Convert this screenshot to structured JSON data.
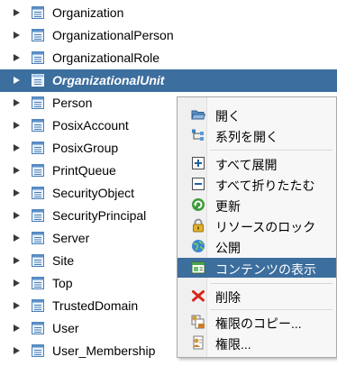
{
  "tree": {
    "items": [
      {
        "label": "Organization"
      },
      {
        "label": "OrganizationalPerson"
      },
      {
        "label": "OrganizationalRole"
      },
      {
        "label": "OrganizationalUnit"
      },
      {
        "label": "Person"
      },
      {
        "label": "PosixAccount"
      },
      {
        "label": "PosixGroup"
      },
      {
        "label": "PrintQueue"
      },
      {
        "label": "SecurityObject"
      },
      {
        "label": "SecurityPrincipal"
      },
      {
        "label": "Server"
      },
      {
        "label": "Site"
      },
      {
        "label": "Top"
      },
      {
        "label": "TrustedDomain"
      },
      {
        "label": "User"
      },
      {
        "label": "User_Membership"
      }
    ],
    "selected_label": "OrganizationalUnit"
  },
  "context_menu": {
    "items": [
      {
        "label": "開く",
        "icon": "folder-open-icon"
      },
      {
        "label": "系列を開く",
        "icon": "hierarchy-icon"
      },
      {
        "label": "すべて展開",
        "icon": "expand-all-icon"
      },
      {
        "label": "すべて折りたたむ",
        "icon": "collapse-all-icon"
      },
      {
        "label": "更新",
        "icon": "refresh-icon"
      },
      {
        "label": "リソースのロック",
        "icon": "lock-icon"
      },
      {
        "label": "公開",
        "icon": "publish-icon"
      },
      {
        "label": "コンテンツの表示",
        "icon": "view-content-icon"
      },
      {
        "label": "削除",
        "icon": "delete-icon"
      },
      {
        "label": "権限のコピー...",
        "icon": "copy-permissions-icon"
      },
      {
        "label": "権限...",
        "icon": "permissions-icon"
      }
    ],
    "highlighted_label": "コンテンツの表示"
  },
  "colors": {
    "selection": "#3c6e9e",
    "menu_background": "#f7f7f7"
  }
}
